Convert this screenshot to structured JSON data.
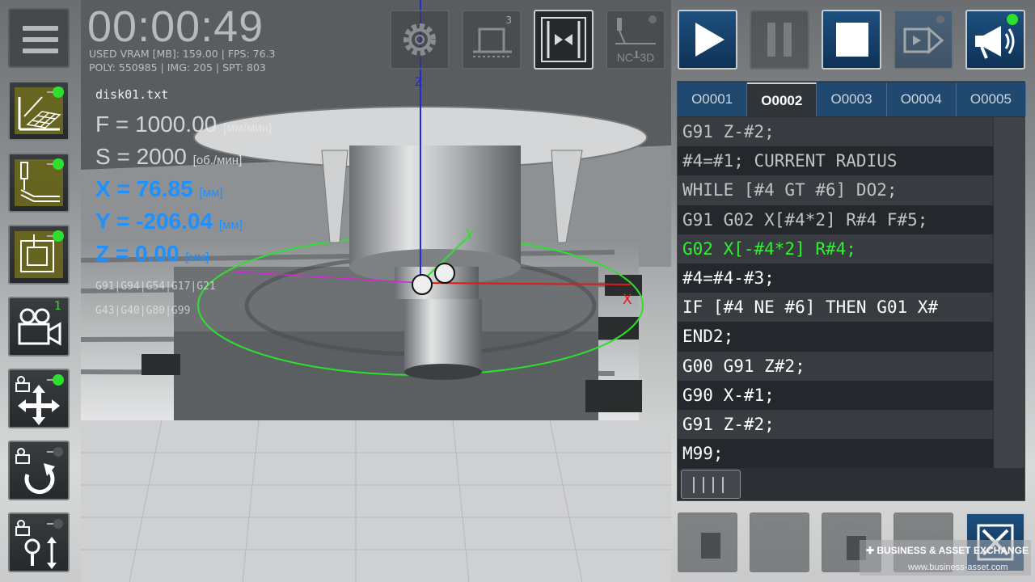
{
  "hud": {
    "timer": "00:00:49",
    "stats_line1": "USED VRAM [MB]: 159.00 | FPS: 76.3",
    "stats_line2": "POLY: 550985 | IMG: 205 | SPT: 803",
    "filename": "disk01.txt",
    "feed": {
      "label": "F = 1000.00",
      "unit": "[мм/мин]"
    },
    "spindle": {
      "label": "S = 2000",
      "unit": "[об./мин]"
    },
    "x": {
      "label": "X = 76.85",
      "unit": "[мм]"
    },
    "y": {
      "label": "Y = -206.04",
      "unit": "[мм]"
    },
    "z": {
      "label": "Z = 0.00",
      "unit": "[мм]"
    },
    "modal_line1": "G91|G94|G54|G17|G21",
    "modal_line2": "G43|G40|G80|G99"
  },
  "viewport": {
    "axis_z": "Z",
    "axis_y": "Y",
    "axis_x": "X"
  },
  "left_toolbar": {
    "camera_badge": "1"
  },
  "top_toolbar": {
    "workpiece_badge": "3",
    "nc3d_label": "NC┸3D"
  },
  "code": {
    "tabs": [
      "O0001",
      "O0002",
      "O0003",
      "O0004",
      "O0005"
    ],
    "active_tab": 1,
    "lines": [
      "G91 Z-#2;",
      "#4=#1; CURRENT RADIUS",
      "WHILE [#4 GT #6] DO2;",
      "G91 G02 X[#4*2] R#4 F#5;",
      "G02 X[-#4*2] R#4;",
      "#4=#4-#3;",
      "IF [#4 NE #6] THEN G01 X#",
      "END2;",
      "G00 G91 Z#2;",
      "G90 X-#1;",
      "G91 Z-#2;",
      "M99;"
    ],
    "highlight_line": 4,
    "highlight_color": "#2ef02e"
  },
  "watermark": {
    "line1": "✚ BUSINESS & ASSET   EXCHANGE",
    "line2": "www.business-asset.com"
  },
  "colors": {
    "accent_blue": "#1d4f7e",
    "coord_blue": "#1e90ff",
    "indicator_green": "#2ee02e"
  }
}
